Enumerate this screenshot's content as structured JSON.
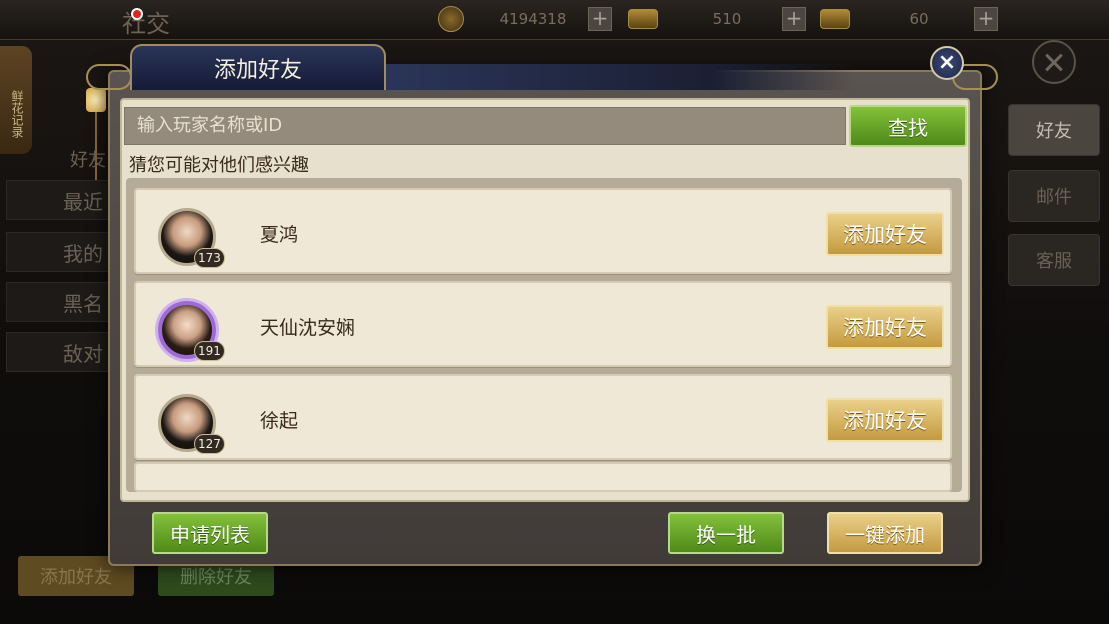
{
  "background": {
    "page_title": "社交",
    "currencies": [
      {
        "icon": "copper-coin-icon",
        "value": "4194318"
      },
      {
        "icon": "silver-ingot-icon",
        "value": "510"
      },
      {
        "icon": "gold-ingot-icon",
        "value": "60"
      }
    ],
    "side_tab": "鲜花记录",
    "left_list": [
      "好友",
      "最近",
      "我的",
      "黑名",
      "敌对"
    ],
    "right_tabs": [
      "好友",
      "邮件",
      "客服"
    ],
    "bottom_buttons": {
      "add": "添加好友",
      "delete": "删除好友"
    }
  },
  "dialog": {
    "title": "添加好友",
    "search": {
      "placeholder": "输入玩家名称或ID",
      "button": "查找"
    },
    "section_title": "猜您可能对他们感兴趣",
    "players": [
      {
        "name": "夏鸿",
        "level": "173",
        "button": "添加好友"
      },
      {
        "name": "天仙沈安娴",
        "level": "191",
        "button": "添加好友"
      },
      {
        "name": "徐起",
        "level": "127",
        "button": "添加好友"
      }
    ],
    "footer": {
      "apply_list": "申请列表",
      "refresh": "换一批",
      "add_all": "一键添加"
    }
  },
  "colors": {
    "green_button": "#6aa62c",
    "gold_button": "#d9b660",
    "panel": "#e7e0cc",
    "title_bar": "#1f2847"
  }
}
